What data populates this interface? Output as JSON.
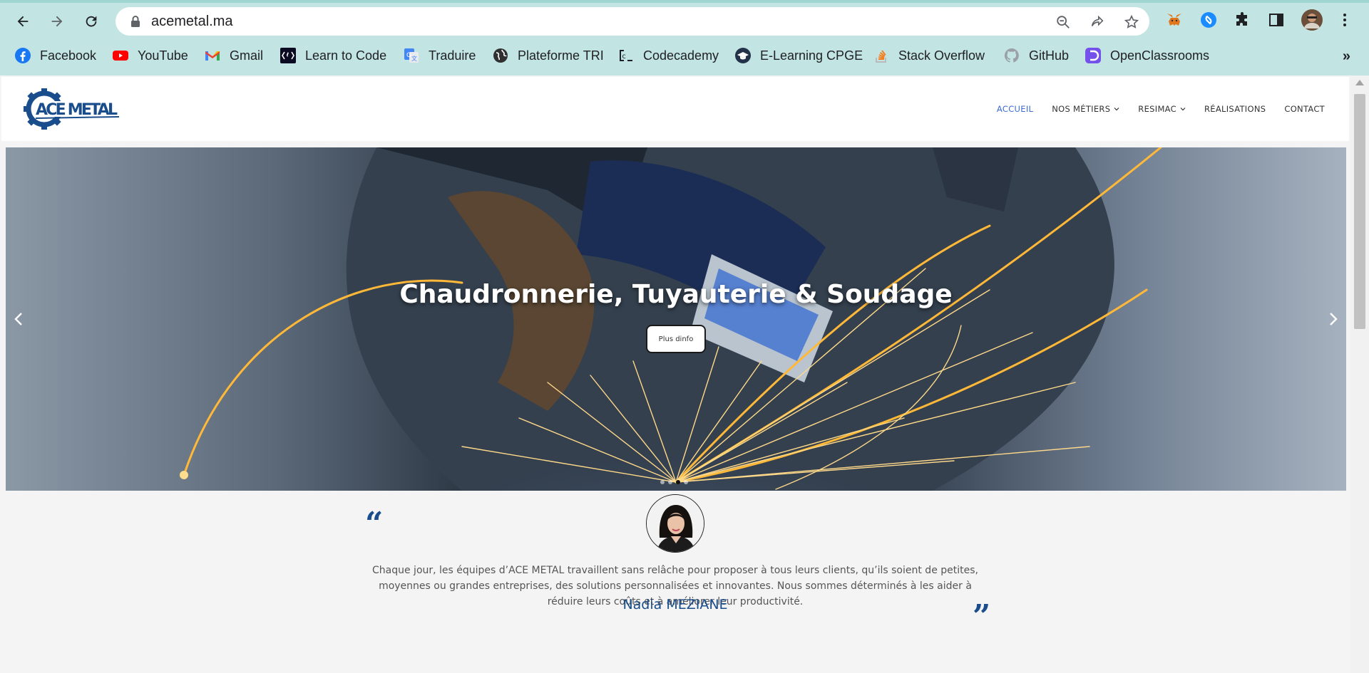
{
  "browser": {
    "url": "acemetal.ma",
    "bookmarks": [
      {
        "label": "Facebook",
        "icon": "facebook-icon"
      },
      {
        "label": "YouTube",
        "icon": "youtube-icon"
      },
      {
        "label": "Gmail",
        "icon": "gmail-icon"
      },
      {
        "label": "Learn to Code",
        "icon": "freecodecamp-icon"
      },
      {
        "label": "Traduire",
        "icon": "google-translate-icon"
      },
      {
        "label": "Plateforme TRI",
        "icon": "globe-icon"
      },
      {
        "label": "Codecademy",
        "icon": "codecademy-icon"
      },
      {
        "label": "E-Learning CPGE",
        "icon": "graduation-cap-icon"
      },
      {
        "label": "Stack Overflow",
        "icon": "stackoverflow-icon"
      },
      {
        "label": "GitHub",
        "icon": "github-icon"
      },
      {
        "label": "OpenClassrooms",
        "icon": "openclassrooms-icon"
      }
    ],
    "more_label": "»"
  },
  "site": {
    "logo_text": "ACE METAL",
    "nav": [
      {
        "label": "ACCUEIL",
        "active": true,
        "has_dropdown": false
      },
      {
        "label": "NOS MÉTIERS",
        "active": false,
        "has_dropdown": true
      },
      {
        "label": "RESIMAC",
        "active": false,
        "has_dropdown": true
      },
      {
        "label": "RÉALISATIONS",
        "active": false,
        "has_dropdown": false
      },
      {
        "label": "CONTACT",
        "active": false,
        "has_dropdown": false
      }
    ],
    "accent_color": "#3c6bd6",
    "brand_color": "#1a4d8c"
  },
  "hero": {
    "title": "Chaudronnerie, Tuyauterie & Soudage",
    "button_label": "Plus dinfo",
    "slide_count": 4,
    "active_slide": 3
  },
  "testimonial": {
    "open_quote": "“",
    "close_quote": "”",
    "text": "Chaque jour, les équipes d’ACE METAL travaillent sans relâche pour proposer à tous leurs clients, qu’ils soient de petites, moyennes ou grandes entreprises, des solutions personnalisées et innovantes. Nous sommes déterminés à les aider à réduire leurs coûts et à améliorer leur productivité.",
    "author": "Nadia MEZIANE"
  }
}
